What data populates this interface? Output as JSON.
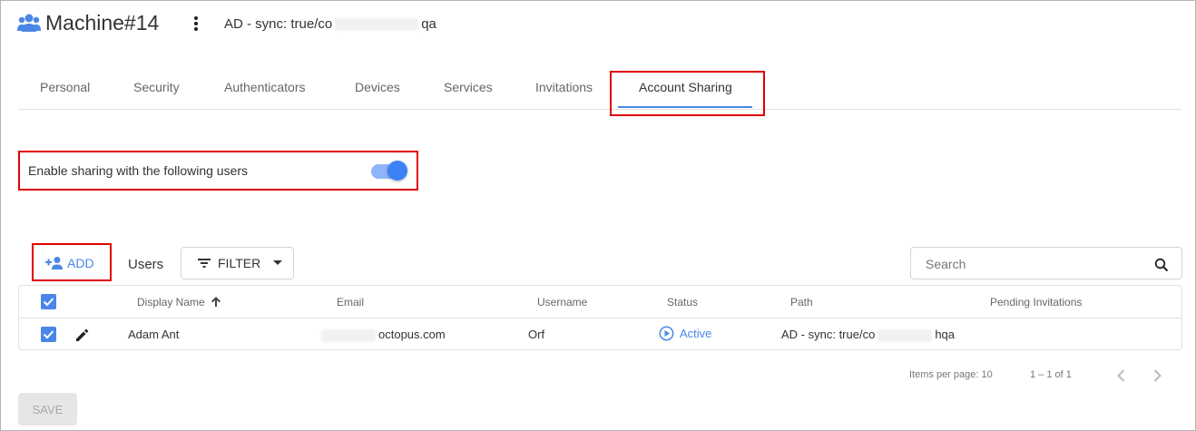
{
  "header": {
    "title": "Machine#14",
    "path_prefix": "AD - sync: true/co",
    "path_suffix": "qa"
  },
  "tabs": [
    {
      "label": "Personal"
    },
    {
      "label": "Security"
    },
    {
      "label": "Authenticators"
    },
    {
      "label": "Devices"
    },
    {
      "label": "Services"
    },
    {
      "label": "Invitations"
    },
    {
      "label": "Account Sharing",
      "active": true
    }
  ],
  "sharing": {
    "label": "Enable sharing with the following users",
    "enabled": true
  },
  "toolbar": {
    "add_label": "ADD",
    "users_label": "Users",
    "filter_label": "FILTER",
    "search_placeholder": "Search"
  },
  "table": {
    "columns": [
      "Display Name",
      "Email",
      "Username",
      "Status",
      "Path",
      "Pending Invitations"
    ],
    "rows": [
      {
        "display_name": "Adam Ant",
        "email_suffix": "octopus.com",
        "username": "Orf",
        "status": "Active",
        "path_prefix": "AD - sync: true/co",
        "path_suffix": "hqa",
        "pending": ""
      }
    ]
  },
  "pagination": {
    "items_per_page_label": "Items per page:",
    "items_per_page": "10",
    "range": "1 – 1 of 1"
  },
  "save_label": "SAVE",
  "colors": {
    "accent": "#4a86e8",
    "highlight_box": "#e00000",
    "toggle_on": "#3c82f6"
  }
}
